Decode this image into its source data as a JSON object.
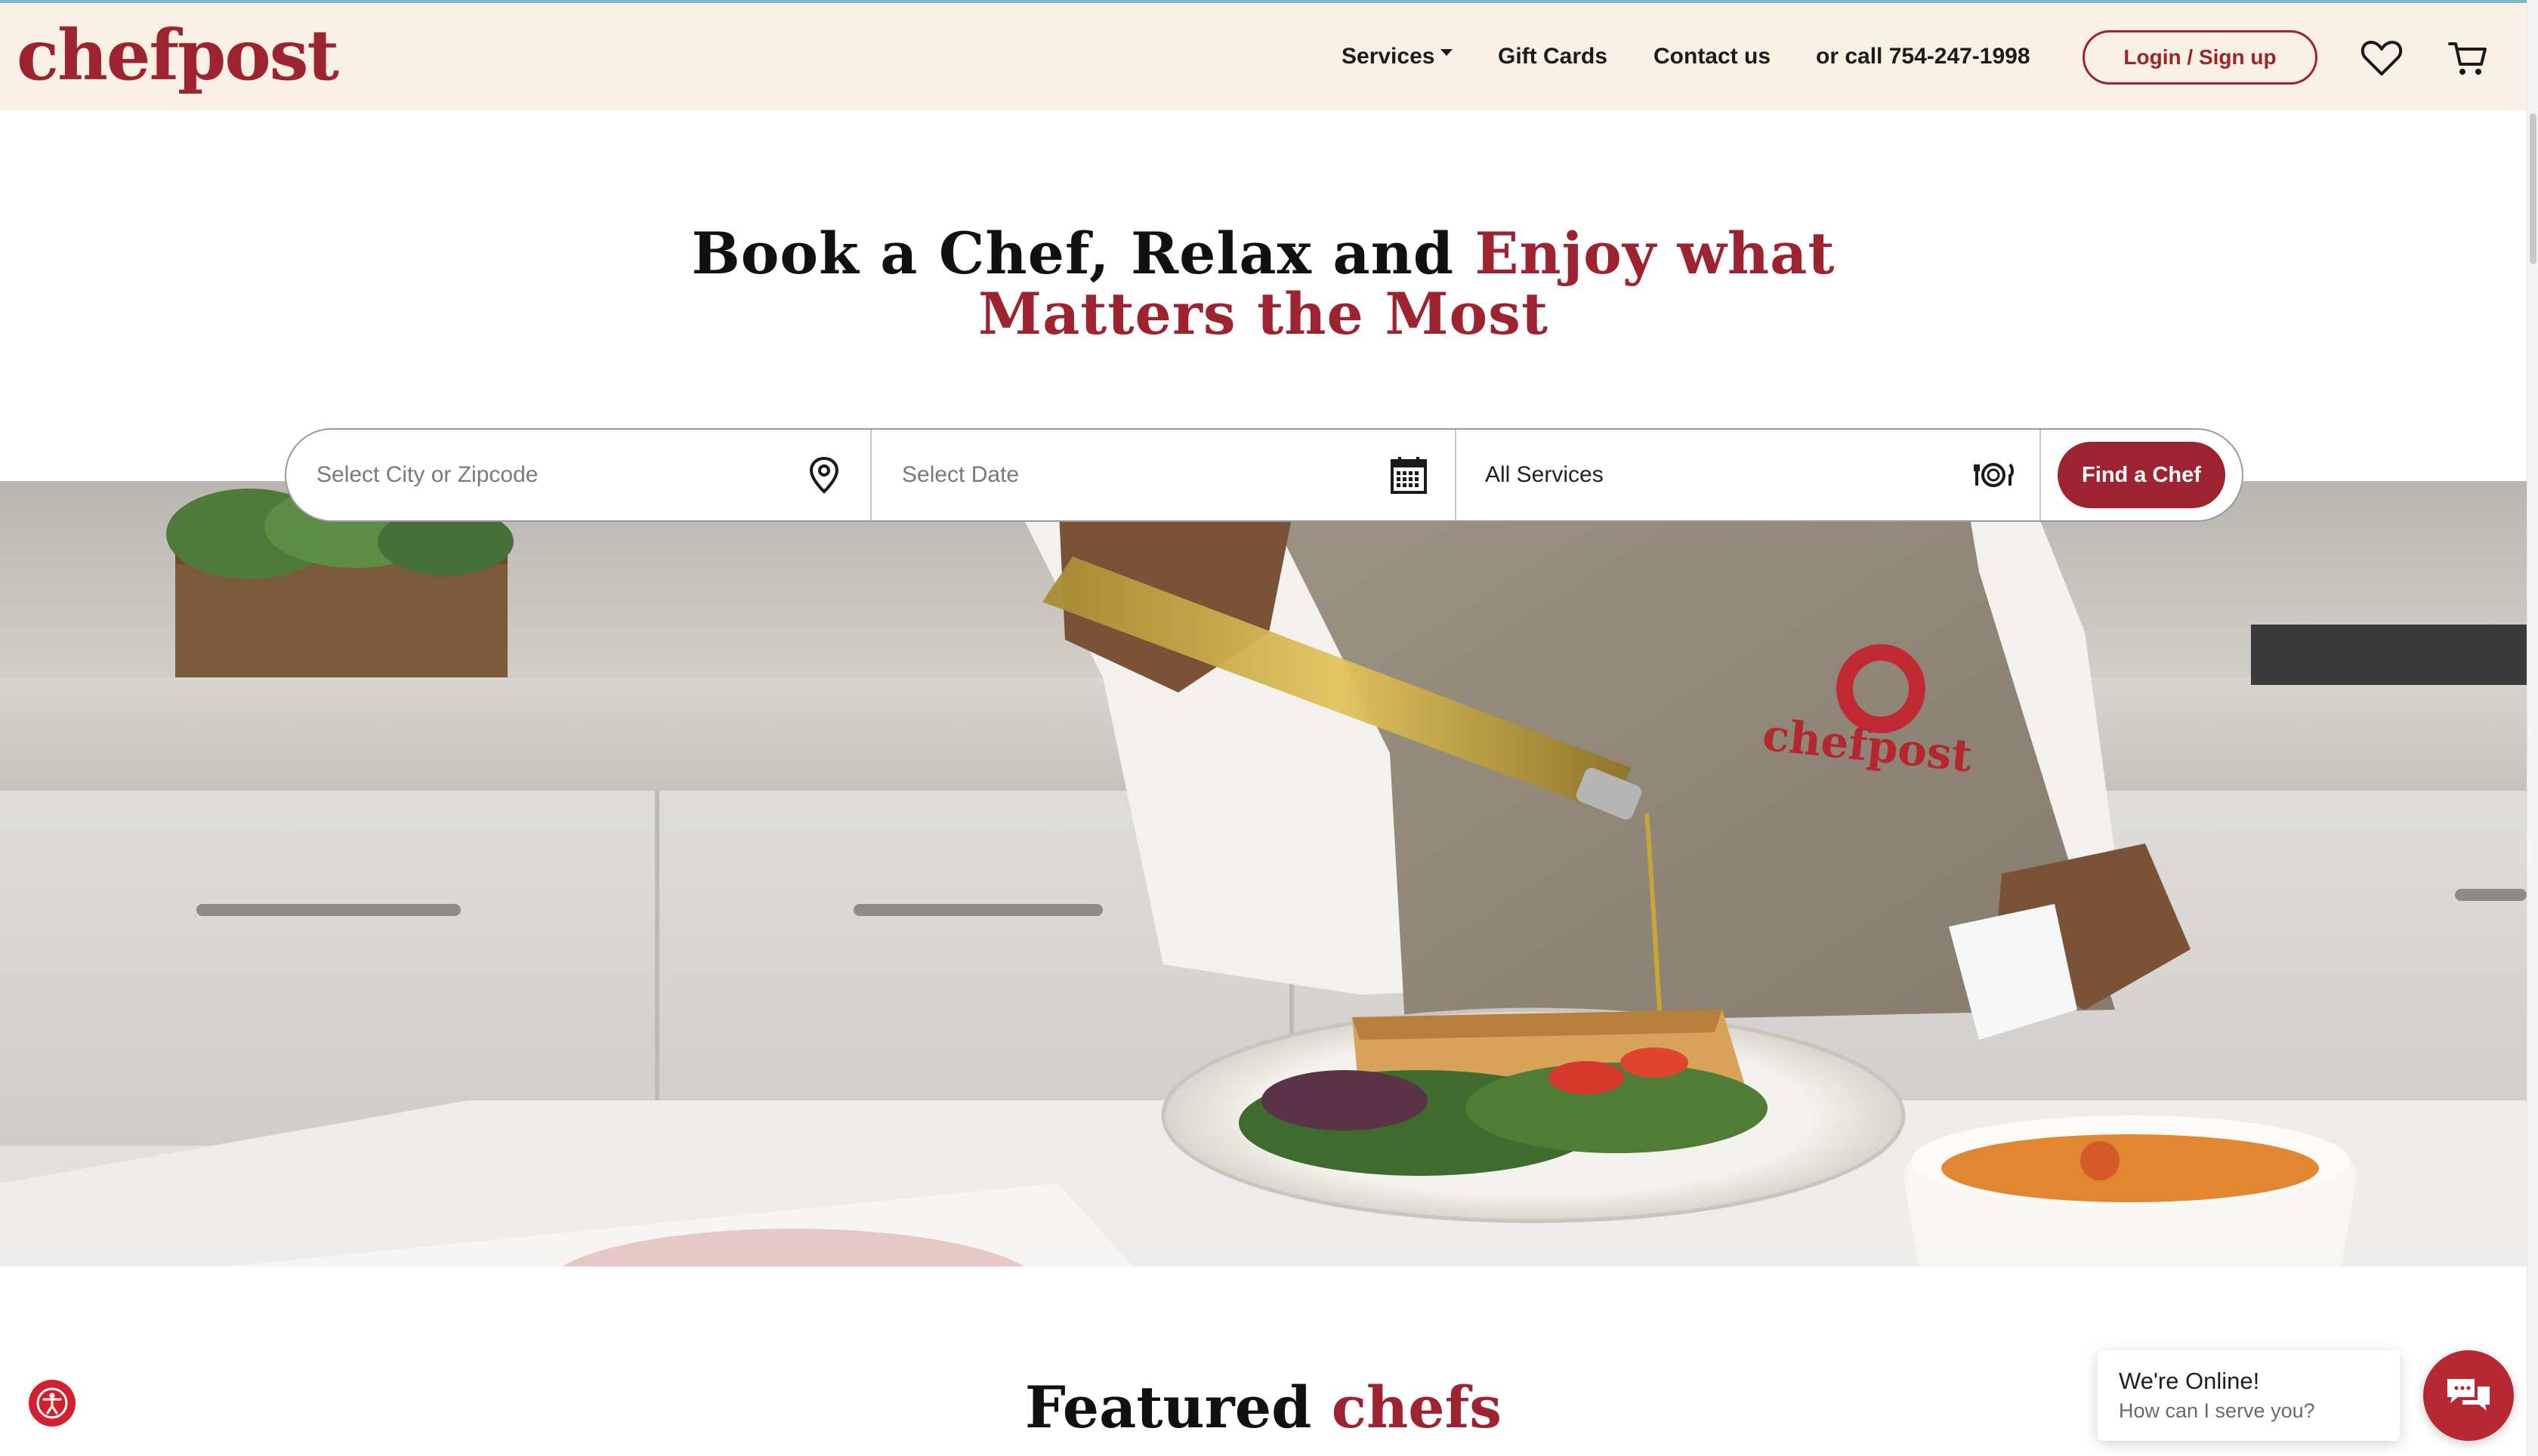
{
  "header": {
    "logo": "chefpost",
    "nav": {
      "services": "Services",
      "gift_cards": "Gift Cards",
      "contact": "Contact us",
      "phone": "or call 754-247-1998"
    },
    "login_label": "Login / Sign up",
    "icons": {
      "wishlist": "heart-icon",
      "cart": "cart-icon"
    }
  },
  "hero": {
    "title_plain": "Book a Chef, Relax and ",
    "title_accent_1": "Enjoy what",
    "title_accent_2": "Matters the Most",
    "image_description": "chef-pouring-olive-oil-photo"
  },
  "search": {
    "city_placeholder": "Select City or Zipcode",
    "date_placeholder": "Select Date",
    "services_value": "All Services",
    "submit_label": "Find a Chef",
    "icons": {
      "city": "location-pin-icon",
      "date": "calendar-icon",
      "services": "plate-cutlery-icon"
    }
  },
  "featured": {
    "title_plain": "Featured ",
    "title_accent": "chefs"
  },
  "chat": {
    "title": "We're Online!",
    "subtitle": "How can I serve you?"
  },
  "colors": {
    "brand": "#9d2330",
    "header_bg": "#f8f0e3",
    "chat_button": "#b82833",
    "accessibility": "#d3202e"
  }
}
